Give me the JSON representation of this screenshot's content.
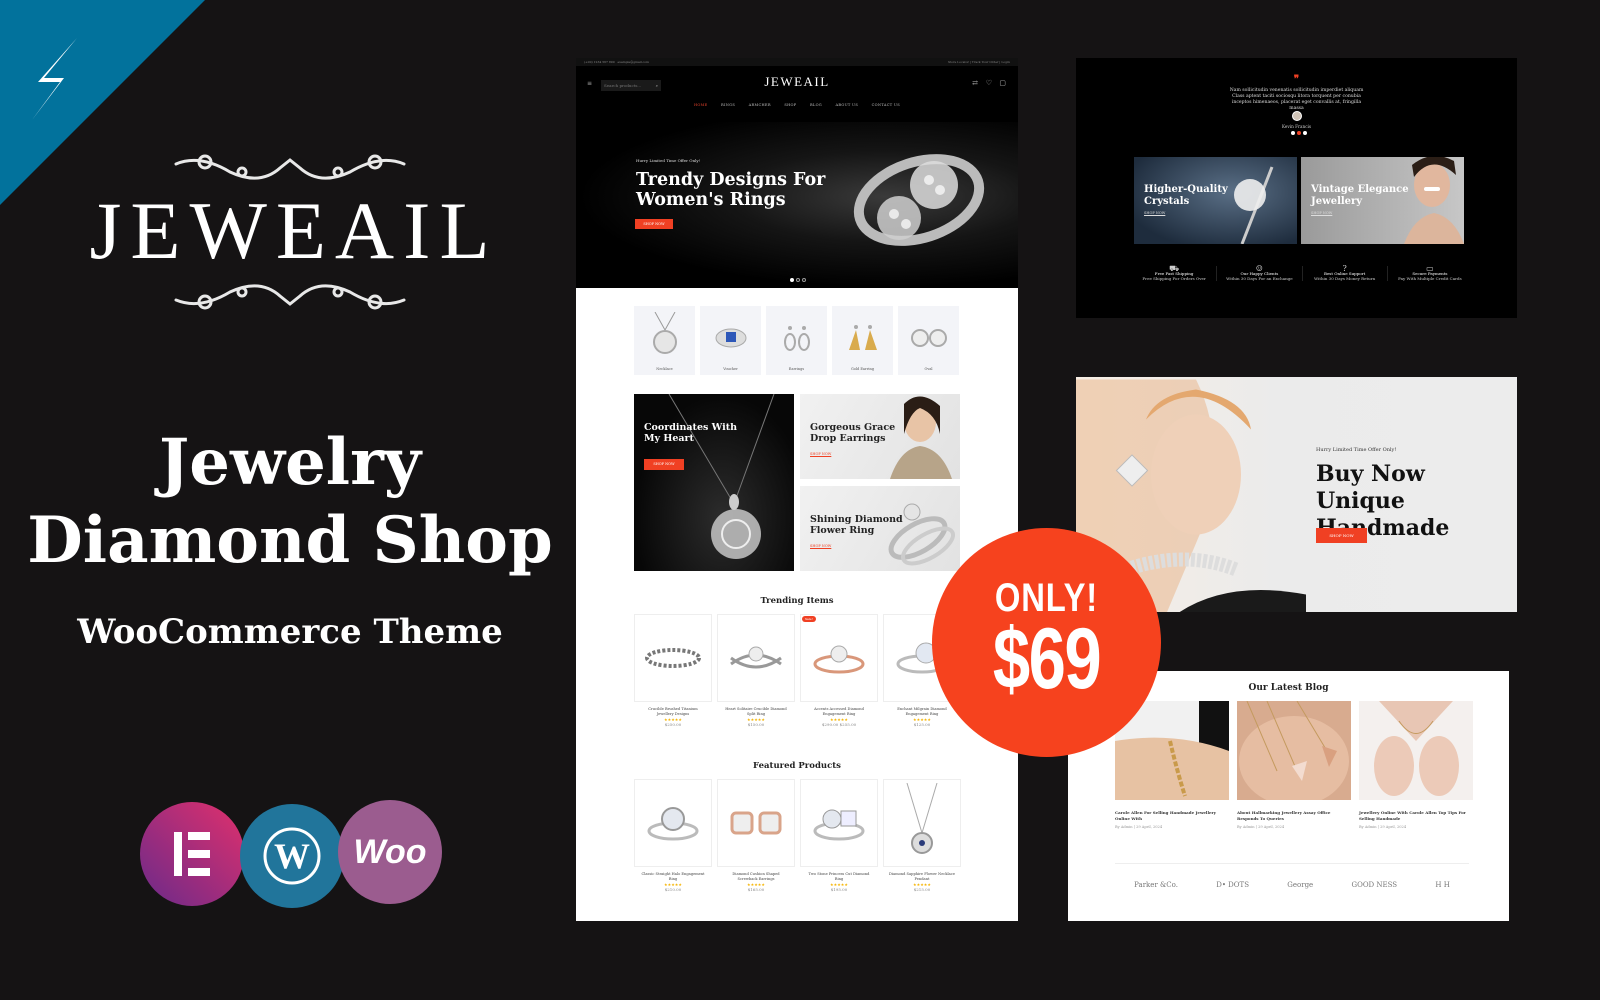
{
  "brand": {
    "name": "JEWEAIL",
    "headline_line1": "Jewelry",
    "headline_line2": "Diamond Shop",
    "subheadline": "WooCommerce Theme",
    "corner_icon": "lightning-bolt-icon",
    "platform_logos": [
      {
        "name": "Elementor",
        "icon": "elementor-logo",
        "color": "#c33170"
      },
      {
        "name": "WordPress",
        "icon": "wordpress-logo",
        "color": "#21759b"
      },
      {
        "name": "WooCommerce",
        "icon": "woo-logo",
        "label": "Woo",
        "color": "#96588a"
      }
    ]
  },
  "colors": {
    "background": "#151314",
    "accent": "#f04023",
    "corner": "#02729c",
    "price_badge": "#f6421e"
  },
  "price_badge": {
    "line1": "ONLY!",
    "price": "$69"
  },
  "demo_home": {
    "topbar": {
      "phone": "(+00) 1234 567 890",
      "email": "example@gmail.com",
      "links": [
        "Store Locator",
        "Track Your Order",
        "Login"
      ]
    },
    "header": {
      "logo": "JEWEAIL",
      "search_placeholder": "Search products...",
      "menu": [
        "HOME",
        "RINGS",
        "ARMCHER",
        "SHOP",
        "BLOG",
        "ABOUT US",
        "CONTACT US"
      ],
      "active_menu": "HOME"
    },
    "hero": {
      "subtitle": "Hurry Limited Time Offer Only!",
      "title_line1": "Trendy Designs For",
      "title_line2": "Women's Rings",
      "button": "SHOP NOW",
      "slide_count": 3,
      "active_slide": 1
    },
    "categories": [
      "Necklace",
      "Voucher",
      "Earrings",
      "Gold Earring",
      "Oval"
    ],
    "banners": [
      {
        "title_line1": "Coordinates With",
        "title_line2": "My Heart",
        "button": "SHOP NOW"
      },
      {
        "title_line1": "Gorgeous Grace",
        "title_line2": "Drop Earrings",
        "link": "SHOP NOW"
      },
      {
        "title_line1": "Shining Diamond",
        "title_line2": "Flower Ring",
        "link": "SHOP NOW"
      }
    ],
    "trending": {
      "title": "Trending Items",
      "items": [
        {
          "name": "Crucible Brushed Titanium Jewellery Designs",
          "rating": "★★★★★",
          "price": "$250.00",
          "sale": false
        },
        {
          "name": "Heart Solitaire Crucible Diamond Split Ring",
          "rating": "★★★★★",
          "price": "$150.00",
          "sale": false
        },
        {
          "name": "Accents Accessed Diamond Engagement Ring",
          "rating": "★★★★★",
          "price": "$290.00 $255.00",
          "sale": true,
          "sale_label": "Sale!"
        },
        {
          "name": "Enchant Milgrain Diamond Engagement Ring",
          "rating": "★★★★★",
          "price": "$125.00",
          "sale": false
        }
      ]
    },
    "featured": {
      "title": "Featured Products",
      "items": [
        {
          "name": "Classic Straight Halo Engagement Ring",
          "rating": "★★★★★",
          "price": "$210.00"
        },
        {
          "name": "Diamond Cushion Shaped Screwback Earrings",
          "rating": "★★★★★",
          "price": "$165.00"
        },
        {
          "name": "Two Stone Princess Cut Diamond Ring",
          "rating": "★★★★★",
          "price": "$195.00"
        },
        {
          "name": "Diamond Sapphire Flower Necklace Pendant",
          "rating": "★★★★★",
          "price": "$215.00"
        }
      ]
    }
  },
  "demo_testimonial": {
    "quote_icon": "quote-icon",
    "text": "Nam sollicitudin venenatis sollicitudin imperdiet aliquam Class aptent taciti sociosqu litora torquent per conubia inceptos himenaeos, placerat eget convallis at, fringilla massa",
    "author": "Kevin Francis",
    "dots": 3,
    "active_dot": 2,
    "banners": [
      {
        "title_line1": "Higher-Quality",
        "title_line2": "Crystals",
        "link": "SHOP NOW"
      },
      {
        "title_line1": "Vintage Elegance",
        "title_line2": "Jewellery",
        "link": "SHOP NOW"
      }
    ],
    "features": [
      {
        "icon": "shipping-icon",
        "title": "Free Fast Shipping",
        "text": "Free Shipping For Orders Over"
      },
      {
        "icon": "smile-icon",
        "title": "Our Happy Clients",
        "text": "Within 30 Days For an Exchange"
      },
      {
        "icon": "support-icon",
        "title": "Best Online Support",
        "text": "Within 30 Days Money Return"
      },
      {
        "icon": "payment-icon",
        "title": "Secure Payments",
        "text": "Pay With Multiple Credit Cards"
      }
    ]
  },
  "demo_offer": {
    "subtitle": "Hurry Limited Time Offer Only!",
    "title_line1": "Buy Now Unique",
    "title_line2": "Handmade",
    "button": "SHOP NOW"
  },
  "demo_blog": {
    "title": "Our Latest Blog",
    "posts": [
      {
        "title": "Carole Allen For Selling Handmade Jewellery Online With",
        "meta": "By Admin | 29 April, 2024"
      },
      {
        "title": "About Hallmarking Jewellery Assay Office Responds To Queries",
        "meta": "By Admin | 29 April, 2024"
      },
      {
        "title": "Jewellery Online With Carole Allen Top Tips For Selling Handmade",
        "meta": "By Admin | 29 April, 2024"
      }
    ],
    "partners": [
      "Parker &Co.",
      "D• DOTS",
      "George",
      "GOOD NESS",
      "H H"
    ]
  }
}
